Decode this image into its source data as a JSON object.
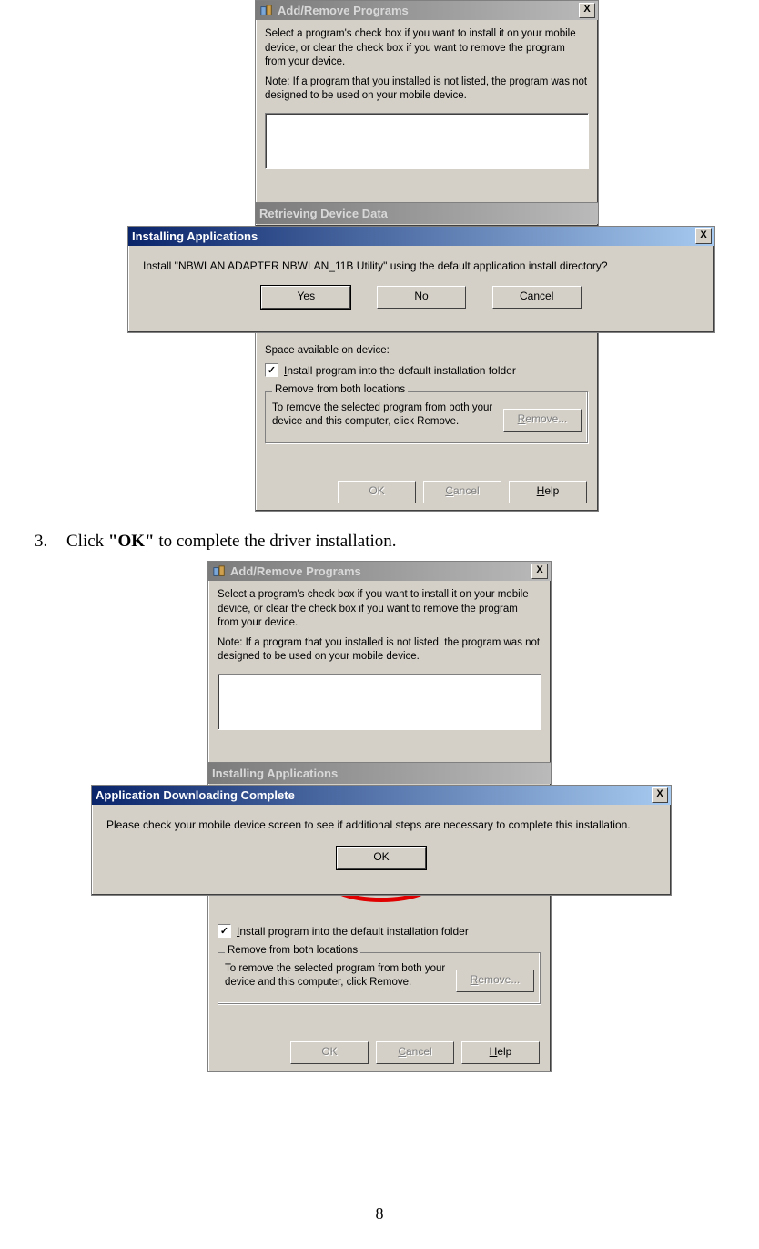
{
  "page_number": "8",
  "step": {
    "number": "3.",
    "text_before": "Click ",
    "bold": "\"OK\"",
    "text_after": " to complete the driver installation."
  },
  "fig1": {
    "arp": {
      "title": "Add/Remove Programs",
      "close": "X",
      "p1": "Select a program's check box if you want to install it on your mobile device, or clear the check box if you want to remove the program from your device.",
      "p2": "Note:  If a program that you installed is not listed, the program was not designed to be used on your mobile device.",
      "space_label": "Space available on device:",
      "chk_label": "Install program into the default installation folder",
      "grp_label": "Remove from both locations",
      "grp_text": "To remove the selected program from both your device and this computer, click Remove.",
      "btn_remove": "Remove...",
      "btn_ok": "OK",
      "btn_cancel": "Cancel",
      "btn_help": "Help"
    },
    "rdd_title": "Retrieving Device Data",
    "install": {
      "title": "Installing Applications",
      "close": "X",
      "msg": "Install \"NBWLAN ADAPTER NBWLAN_11B Utility\" using the default application install directory?",
      "yes": "Yes",
      "no": "No",
      "cancel": "Cancel"
    }
  },
  "fig2": {
    "arp": {
      "title": "Add/Remove Programs",
      "close": "X",
      "p1": "Select a program's check box if you want to install it on your mobile device, or clear the check box if you want to remove the program from your device.",
      "p2": "Note:  If a program that you installed is not listed, the program was not designed to be used on your mobile device.",
      "chk_label": "Install program into the default installation folder",
      "grp_label": "Remove from both locations",
      "grp_text": "To remove the selected program from both your device and this computer, click Remove.",
      "btn_remove": "Remove...",
      "btn_ok": "OK",
      "btn_cancel": "Cancel",
      "btn_help": "Help"
    },
    "iap_title": "Installing Applications",
    "adc": {
      "title": "Application Downloading Complete",
      "close": "X",
      "msg": "Please check your mobile device screen to see if additional steps are necessary to complete this installation.",
      "ok": "OK"
    }
  }
}
